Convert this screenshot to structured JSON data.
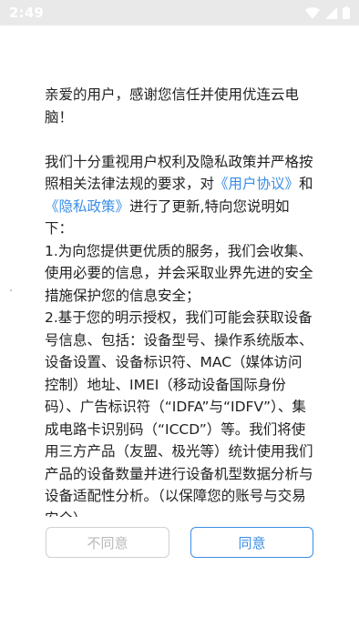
{
  "status_bar": {
    "time": "2:49",
    "icons": [
      "wifi-icon",
      "cellular-signal-icon",
      "battery-icon"
    ]
  },
  "dialog": {
    "greeting": "亲爱的用户，感谢您信任并使用优连云电脑！",
    "intro_before": "我们十分重视用户权利及隐私政策并严格按照相关法律法规的要求，对",
    "link_user_agreement": "《用户协议》",
    "and_text": "和",
    "link_privacy_policy": "《隐私政策》",
    "intro_after": "进行了更新,特向您说明如下：",
    "point_1": "1.为向您提供更优质的服务，我们会收集、使用必要的信息，并会采取业界先进的安全措施保护您的信息安全；",
    "point_2": "2.基于您的明示授权，我们可能会获取设备号信息、包括：设备型号、操作系统版本、设备设置、设备标识符、MAC（媒体访问控制）地址、IMEI（移动设备国际身份码）、广告标识符（“IDFA”与“IDFV”）、集成电路卡识别码（“ICCD”）等。我们将使用三方产品（友盟、极光等）统计使用我们产品的设备数量并进行设备机型数据分析与设备适配性分析。（以保障您的账号与交易安全）"
  },
  "buttons": {
    "disagree_label": "不同意",
    "agree_label": "同意"
  },
  "colors": {
    "link": "#3a8ee6",
    "status_bar_bg": "#e9e9e9",
    "disabled_text": "#b8b8b8"
  }
}
